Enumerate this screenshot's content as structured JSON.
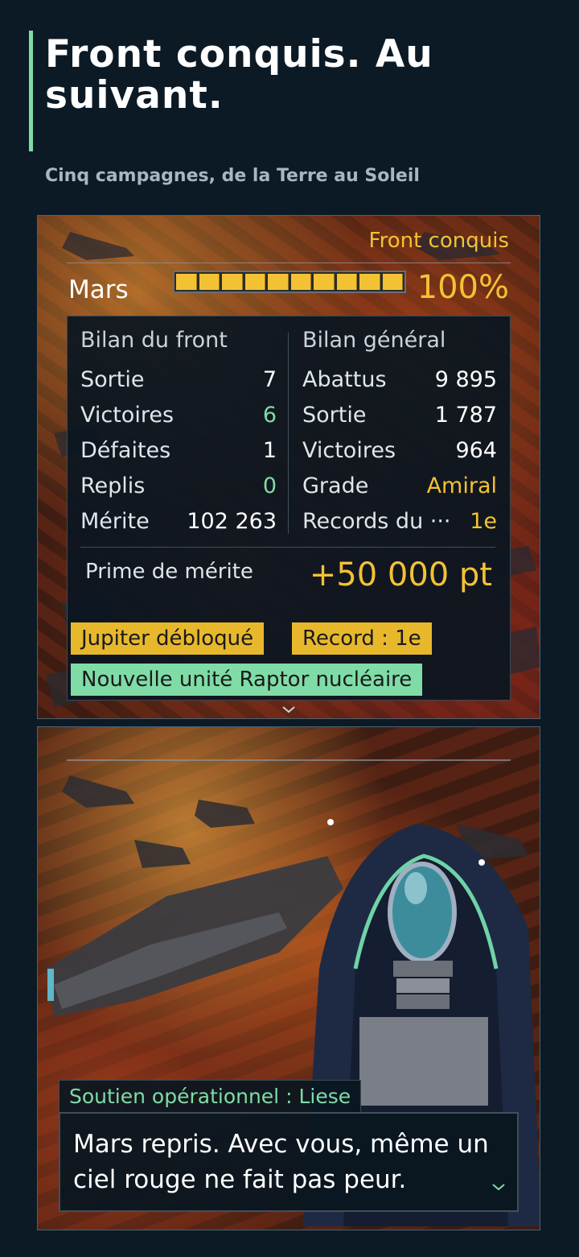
{
  "header": {
    "title": "Front conquis. Au suivant.",
    "subtitle": "Cinq campagnes, de la Terre au Soleil"
  },
  "result": {
    "status": "Front conquis",
    "planet": "Mars",
    "progress_percent": 100,
    "progress_label": "100%",
    "progress_segments": 10
  },
  "front_stats": {
    "heading": "Bilan du front",
    "rows": [
      {
        "label": "Sortie",
        "value": "7"
      },
      {
        "label": "Victoires",
        "value": "6"
      },
      {
        "label": "Défaites",
        "value": "1"
      },
      {
        "label": "Replis",
        "value": "0"
      },
      {
        "label": "Mérite",
        "value": "102 263"
      }
    ]
  },
  "general_stats": {
    "heading": "Bilan général",
    "rows": [
      {
        "label": "Abattus",
        "value": "9 895"
      },
      {
        "label": "Sortie",
        "value": "1 787"
      },
      {
        "label": "Victoires",
        "value": "964"
      },
      {
        "label": "Grade",
        "value": "Amiral"
      },
      {
        "label": "Records du ···",
        "value": "1e"
      }
    ]
  },
  "merit_bonus": {
    "label": "Prime de mérite",
    "value": "+50 000 pt"
  },
  "rewards": [
    {
      "text": "Jupiter débloqué"
    },
    {
      "text": "Record : 1e"
    },
    {
      "text": "Nouvelle unité Raptor nucléaire"
    }
  ],
  "dialog": {
    "speaker": "Soutien opérationnel : Liese",
    "text": "Mars repris. Avec vous, même un ciel rouge ne fait pas peur."
  },
  "colors": {
    "accent_green": "#7fdca6",
    "accent_gold": "#f3c234",
    "background": "#0c1a26"
  },
  "icons": {
    "advance": "chevron-down-icon"
  }
}
